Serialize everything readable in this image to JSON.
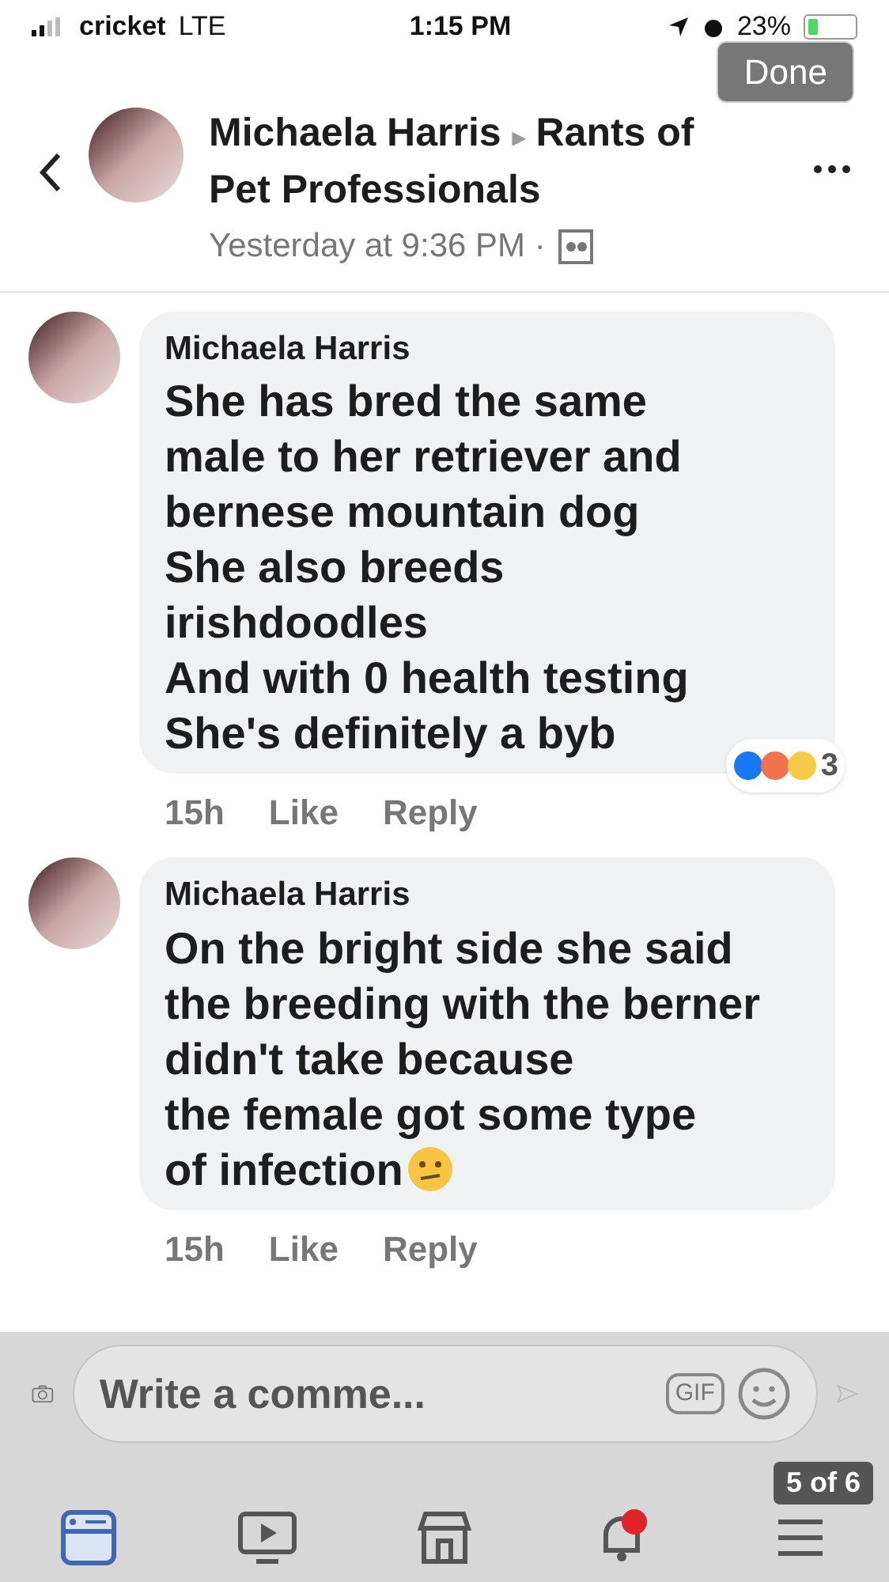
{
  "status_bar": {
    "carrier": "cricket",
    "network": "LTE",
    "time": "1:15 PM",
    "battery": "23%",
    "level": 0.23
  },
  "viewer": {
    "done": "Done",
    "counter": "5 of 6"
  },
  "post": {
    "author": "Michaela Harris",
    "separator": "▸",
    "group": "Rants of Pet Professionals",
    "time": "Yesterday at 9:36 PM ·"
  },
  "comments": [
    {
      "author": "Michaela Harris",
      "lines": [
        "She has bred the same",
        "male to her retriever and",
        "bernese mountain dog",
        "She also breeds",
        "irishdoodles",
        "And with 0 health testing",
        "She's definitely a byb"
      ],
      "emoji": false,
      "age": "15h",
      "like": "Like",
      "reply": "Reply",
      "reactions": "3"
    },
    {
      "author": "Michaela Harris",
      "lines": [
        "On the bright side she said",
        "the breeding with the berner",
        "didn't take because",
        "the female got some type",
        "of infection"
      ],
      "emoji": true,
      "age": "15h",
      "like": "Like",
      "reply": "Reply"
    }
  ],
  "composer": {
    "placeholder": "Write a comme...",
    "gif": "GIF"
  },
  "tabs": [
    {
      "kind": "news",
      "selected": true
    },
    {
      "kind": "video",
      "selected": false
    },
    {
      "kind": "market",
      "selected": false
    },
    {
      "kind": "bell",
      "selected": false
    },
    {
      "kind": "menu",
      "selected": false
    }
  ]
}
